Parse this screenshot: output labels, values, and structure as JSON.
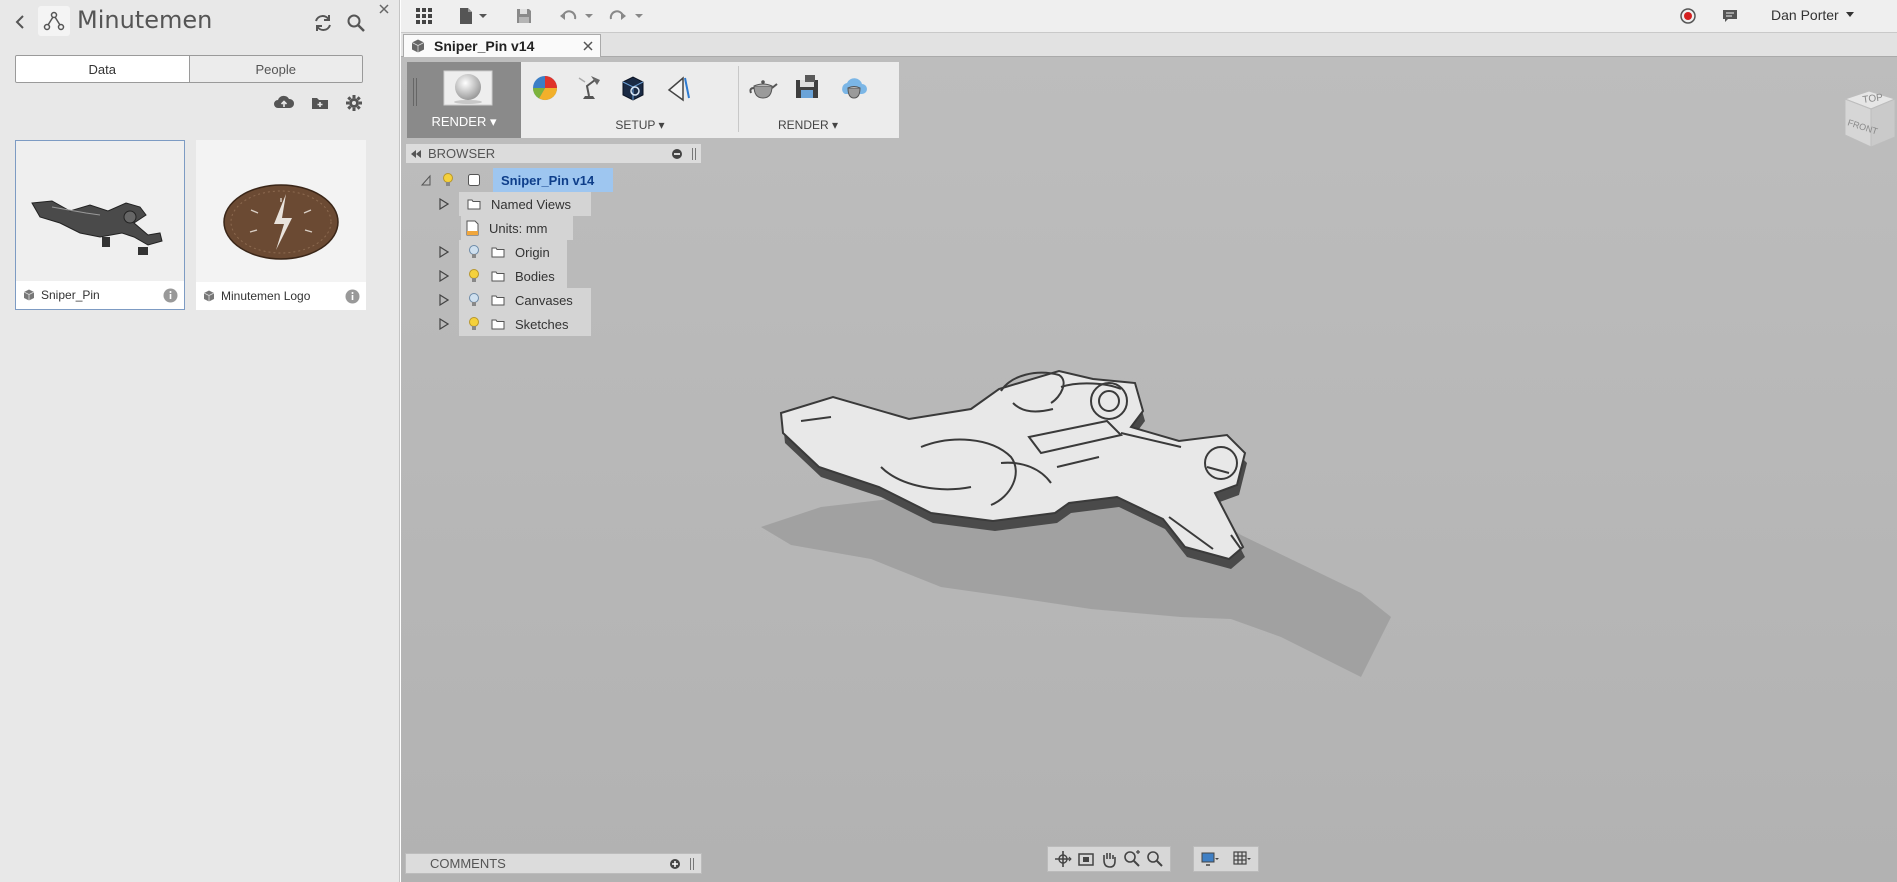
{
  "data_panel": {
    "project_title": "Minutemen",
    "tabs": [
      {
        "label": "Data",
        "active": true
      },
      {
        "label": "People",
        "active": false
      }
    ],
    "files": [
      {
        "name": "Sniper_Pin",
        "selected": true
      },
      {
        "name": "Minutemen Logo",
        "selected": false
      }
    ]
  },
  "toolbar": {
    "user_name": "Dan Porter"
  },
  "document_tab": {
    "label": "Sniper_Pin v14"
  },
  "ribbon": {
    "workspace_label": "RENDER ▾",
    "groups": [
      {
        "label": "SETUP ▾"
      },
      {
        "label": "RENDER ▾"
      }
    ]
  },
  "browser": {
    "title": "BROWSER",
    "root": "Sniper_Pin v14",
    "nodes": [
      "Named Views",
      "Units: mm",
      "Origin",
      "Bodies",
      "Canvases",
      "Sketches"
    ]
  },
  "comments": {
    "title": "COMMENTS"
  },
  "viewcube": {
    "top": "TOP",
    "front": "FRONT"
  },
  "colors": {
    "accent_blue": "#9ec6f0",
    "record_red": "#d42020"
  }
}
